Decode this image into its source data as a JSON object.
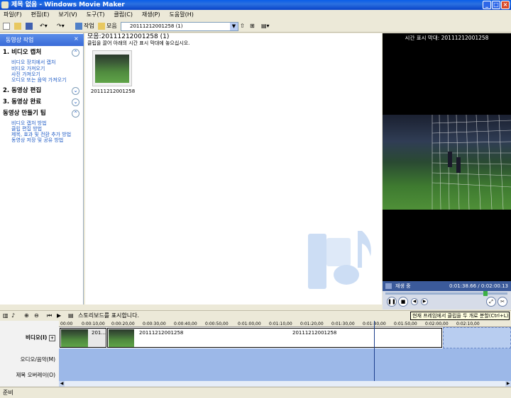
{
  "window": {
    "title": "제목 없음 - Windows Movie Maker"
  },
  "menu": [
    "파일(F)",
    "편집(E)",
    "보기(V)",
    "도구(T)",
    "클립(C)",
    "재생(P)",
    "도움말(H)"
  ],
  "toolbar": {
    "tasks_label": "작업",
    "collections_label": "모음",
    "collection_value": "20111212001258 (1)"
  },
  "taskpane": {
    "header": "동영상 작업",
    "sections": [
      {
        "title": "1. 비디오 캡처",
        "links": [
          "비디오 장치에서 캡처",
          "비디오 가져오기",
          "사진 가져오기",
          "오디오 또는 음악 가져오기"
        ]
      },
      {
        "title": "2. 동영상 편집",
        "links": []
      },
      {
        "title": "3. 동영상 완료",
        "links": []
      },
      {
        "title": "동영상 만들기 팁",
        "links": [
          "비디오 캡처 방법",
          "클립 편집 방법",
          "제목, 효과 및 전환 추가 방법",
          "동영상 저장 및 공유 방법"
        ]
      }
    ]
  },
  "collection": {
    "title": "모음:20111212001258 (1)",
    "subtitle": "클립을 끌어 아래의 시간 표시 막대에 놓으십시오.",
    "clip_name": "20111212001258"
  },
  "preview": {
    "title": "시간 표시 막대: 20111212001258",
    "status": "재생 중",
    "time": "0:01:38.66 / 0:02:00.13"
  },
  "timeline": {
    "storyboard_label": "스토리보드를 표시합니다.",
    "tooltip": "현재 프레임에서 클립을 두 개로 분할(Ctrl+L)",
    "tracks": [
      "비디오(I)",
      "오디오/음악(M)",
      "제목 오버레이(O)"
    ],
    "ruler": [
      "00:00",
      "0:00:10,00",
      "0:00:20,00",
      "0:00:30,00",
      "0:00:40,00",
      "0:00:50,00",
      "0:01:00,00",
      "0:01:10,00",
      "0:01:20,00",
      "0:01:30,00",
      "0:01:40,00",
      "0:01:50,00",
      "0:02:00,00",
      "0:02:10,00"
    ],
    "clips": [
      "201...",
      "20111212001258",
      "20111212001258"
    ]
  },
  "status": {
    "text": "준비"
  },
  "colors": {
    "title_bar": "#0A5EE8",
    "preview_bg": "#000000",
    "track_bg": "#9CB8E8"
  }
}
